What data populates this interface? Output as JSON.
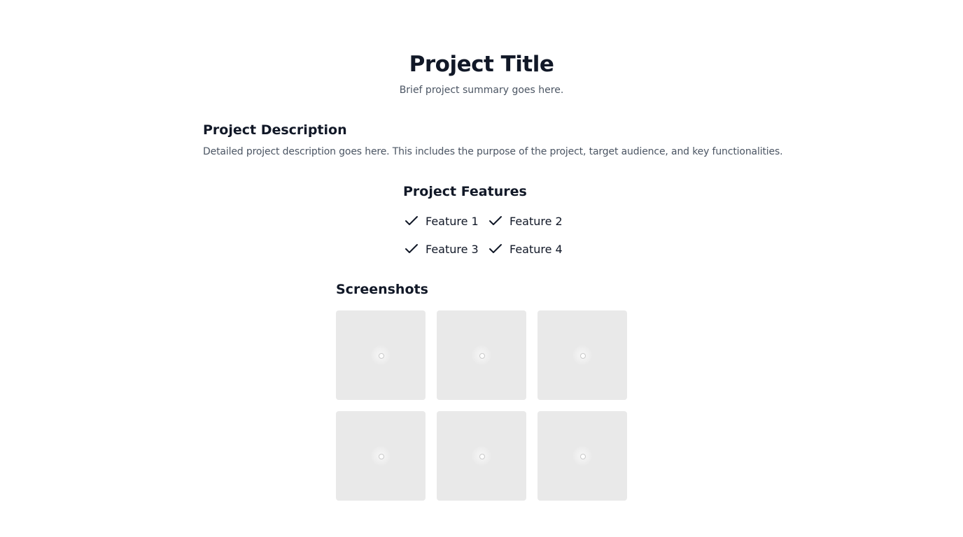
{
  "header": {
    "title": "Project Title",
    "summary": "Brief project summary goes here."
  },
  "description": {
    "heading": "Project Description",
    "text": "Detailed project description goes here. This includes the purpose of the project, target audience, and key functionalities."
  },
  "features": {
    "heading": "Project Features",
    "items": [
      {
        "label": "Feature 1",
        "icon": "check-icon"
      },
      {
        "label": "Feature 2",
        "icon": "check-icon"
      },
      {
        "label": "Feature 3",
        "icon": "check-icon"
      },
      {
        "label": "Feature 4",
        "icon": "check-icon"
      }
    ]
  },
  "screenshots": {
    "heading": "Screenshots",
    "count": 6,
    "placeholder_icon": "loading-spinner-icon"
  },
  "colors": {
    "heading": "#111827",
    "muted_text": "#4b5563",
    "thumbnail_bg": "#e9e9e9",
    "background": "#ffffff"
  }
}
